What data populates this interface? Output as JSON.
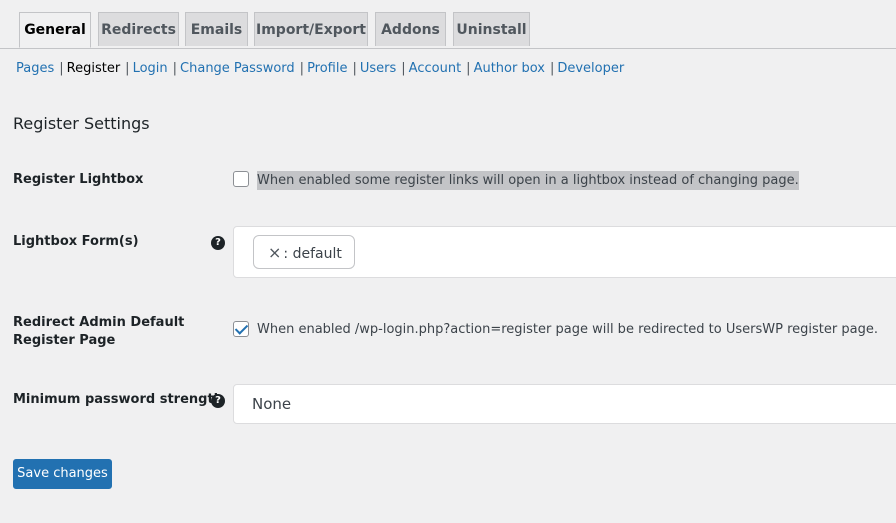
{
  "tabs": [
    {
      "label": "General",
      "active": true
    },
    {
      "label": "Redirects"
    },
    {
      "label": "Emails"
    },
    {
      "label": "Import/Export"
    },
    {
      "label": "Addons"
    },
    {
      "label": "Uninstall"
    }
  ],
  "subnav": [
    {
      "label": "Pages"
    },
    {
      "label": "Register",
      "current": true
    },
    {
      "label": "Login"
    },
    {
      "label": "Change Password"
    },
    {
      "label": "Profile"
    },
    {
      "label": "Users"
    },
    {
      "label": "Account"
    },
    {
      "label": "Author box"
    },
    {
      "label": "Developer"
    }
  ],
  "separator": "|",
  "section_title": "Register Settings",
  "settings": {
    "register_lightbox": {
      "label": "Register Lightbox",
      "checked": false,
      "description": "When enabled some register links will open in a lightbox instead of changing page."
    },
    "lightbox_forms": {
      "label": "Lightbox Form(s)",
      "help_icon": "question-circle-icon",
      "help_glyph": "?",
      "chip_remove_glyph": "×",
      "chip_label": ": default"
    },
    "redirect_admin": {
      "label_line1": "Redirect Admin Default",
      "label_line2": "Register Page",
      "checked": true,
      "description": "When enabled /wp-login.php?action=register page will be redirected to UsersWP register page."
    },
    "min_password": {
      "label": "Minimum password strength",
      "help_icon": "question-circle-icon",
      "help_glyph": "?",
      "value": "None"
    }
  },
  "save_label": "Save changes",
  "colors": {
    "accent": "#2271b1",
    "background": "#f0f0f1"
  }
}
